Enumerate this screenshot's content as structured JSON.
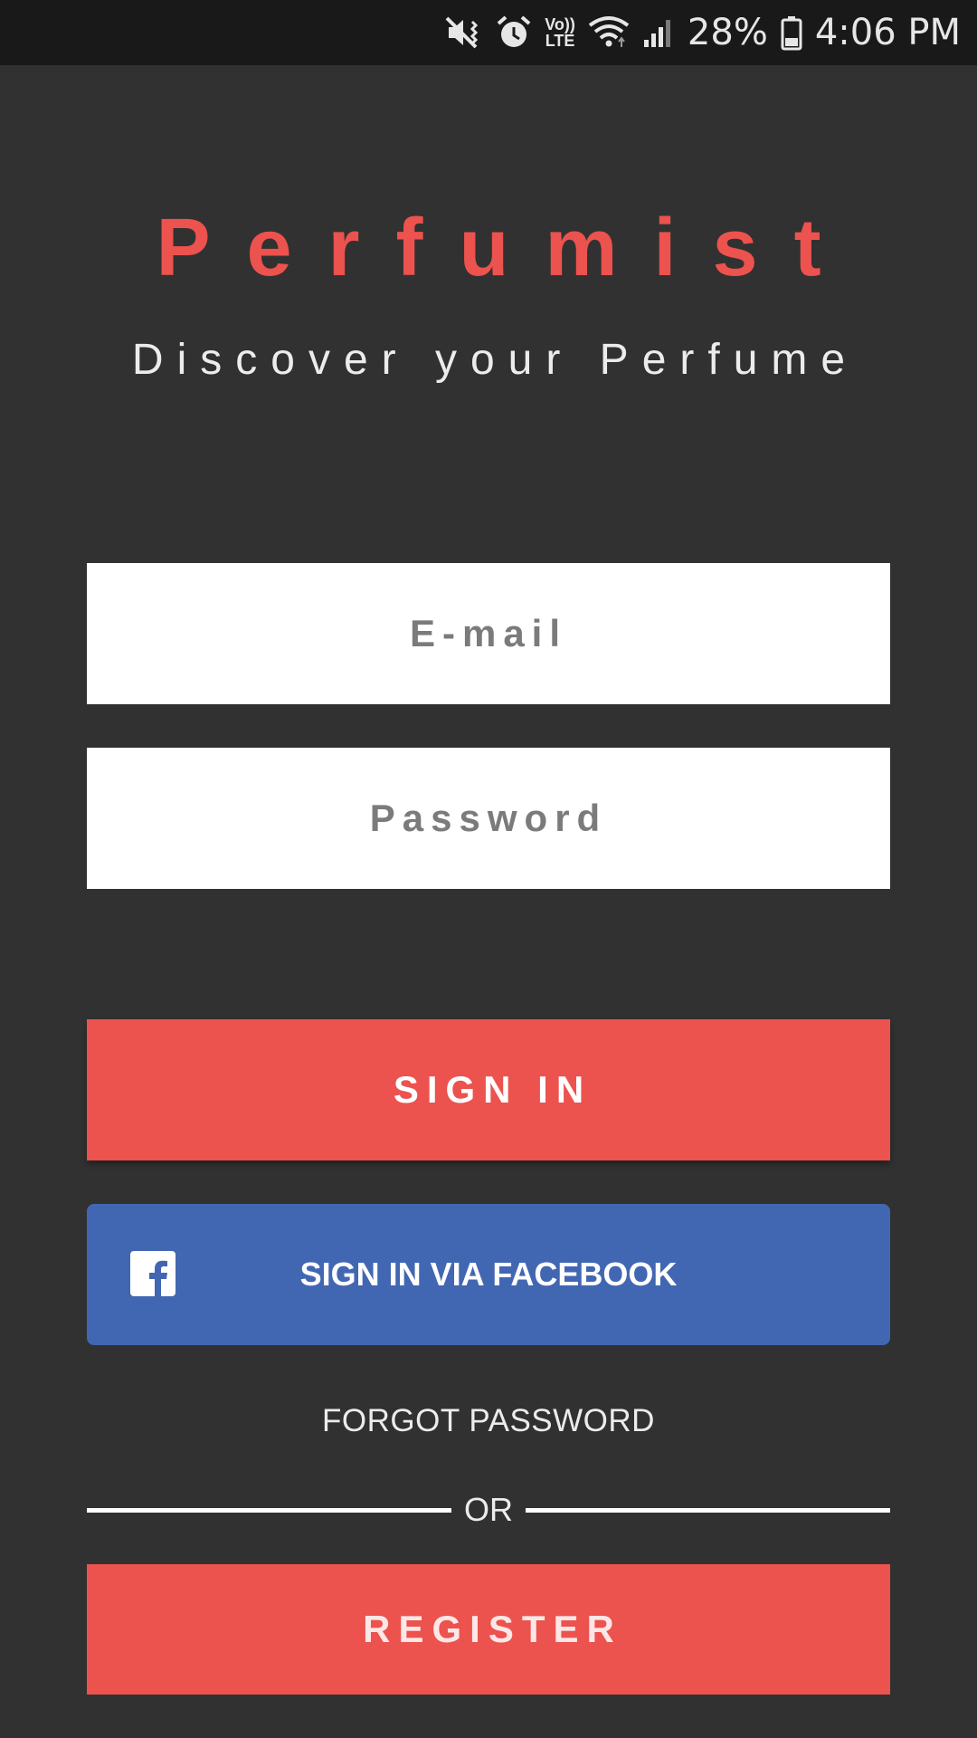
{
  "status_bar": {
    "icons": [
      "mute-vibrate-icon",
      "alarm-icon",
      "volte-icon",
      "wifi-icon",
      "signal-icon",
      "battery-icon"
    ],
    "volte_top": "Vo))",
    "volte_bottom": "LTE",
    "battery_percent": "28%",
    "time": "4:06 PM"
  },
  "header": {
    "title": "Perfumist",
    "subtitle": "Discover your Perfume"
  },
  "form": {
    "email_placeholder": "E-mail",
    "password_placeholder": "Password"
  },
  "actions": {
    "sign_in_label": "SIGN IN",
    "facebook_label": "SIGN IN VIA FACEBOOK",
    "forgot_password_label": "FORGOT PASSWORD",
    "divider_label": "OR",
    "register_label": "REGISTER"
  },
  "colors": {
    "background": "#313131",
    "status_bar": "#191919",
    "accent": "#ec524e",
    "facebook": "#4267b2",
    "field_background": "#ffffff"
  }
}
